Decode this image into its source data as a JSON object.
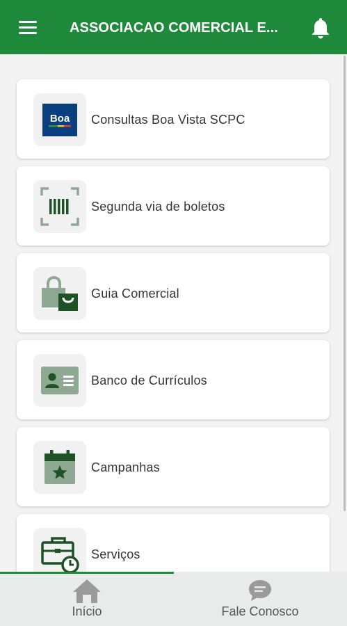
{
  "header": {
    "title": "ASSOCIACAO COMERCIAL E...",
    "menu_icon": "hamburger-menu-icon",
    "notification_icon": "bell-icon",
    "color": "#1f8a3c"
  },
  "menu": {
    "items": [
      {
        "label": "Consultas Boa Vista SCPC",
        "icon": "boa-vista-logo-icon",
        "logo_text": "Boa"
      },
      {
        "label": "Segunda via de boletos",
        "icon": "barcode-icon"
      },
      {
        "label": "Guia Comercial",
        "icon": "shopping-bag-icon"
      },
      {
        "label": "Banco de Currículos",
        "icon": "id-card-icon"
      },
      {
        "label": "Campanhas",
        "icon": "calendar-star-icon"
      },
      {
        "label": "Serviços",
        "icon": "briefcase-clock-icon"
      }
    ]
  },
  "bottom_nav": {
    "items": [
      {
        "label": "Início",
        "icon": "home-icon",
        "active": true
      },
      {
        "label": "Fale Conosco",
        "icon": "chat-bubble-icon",
        "active": false
      }
    ]
  },
  "colors": {
    "primary": "#1f8a3c",
    "icon_dark": "#1e5226",
    "icon_light": "#8ea891"
  }
}
